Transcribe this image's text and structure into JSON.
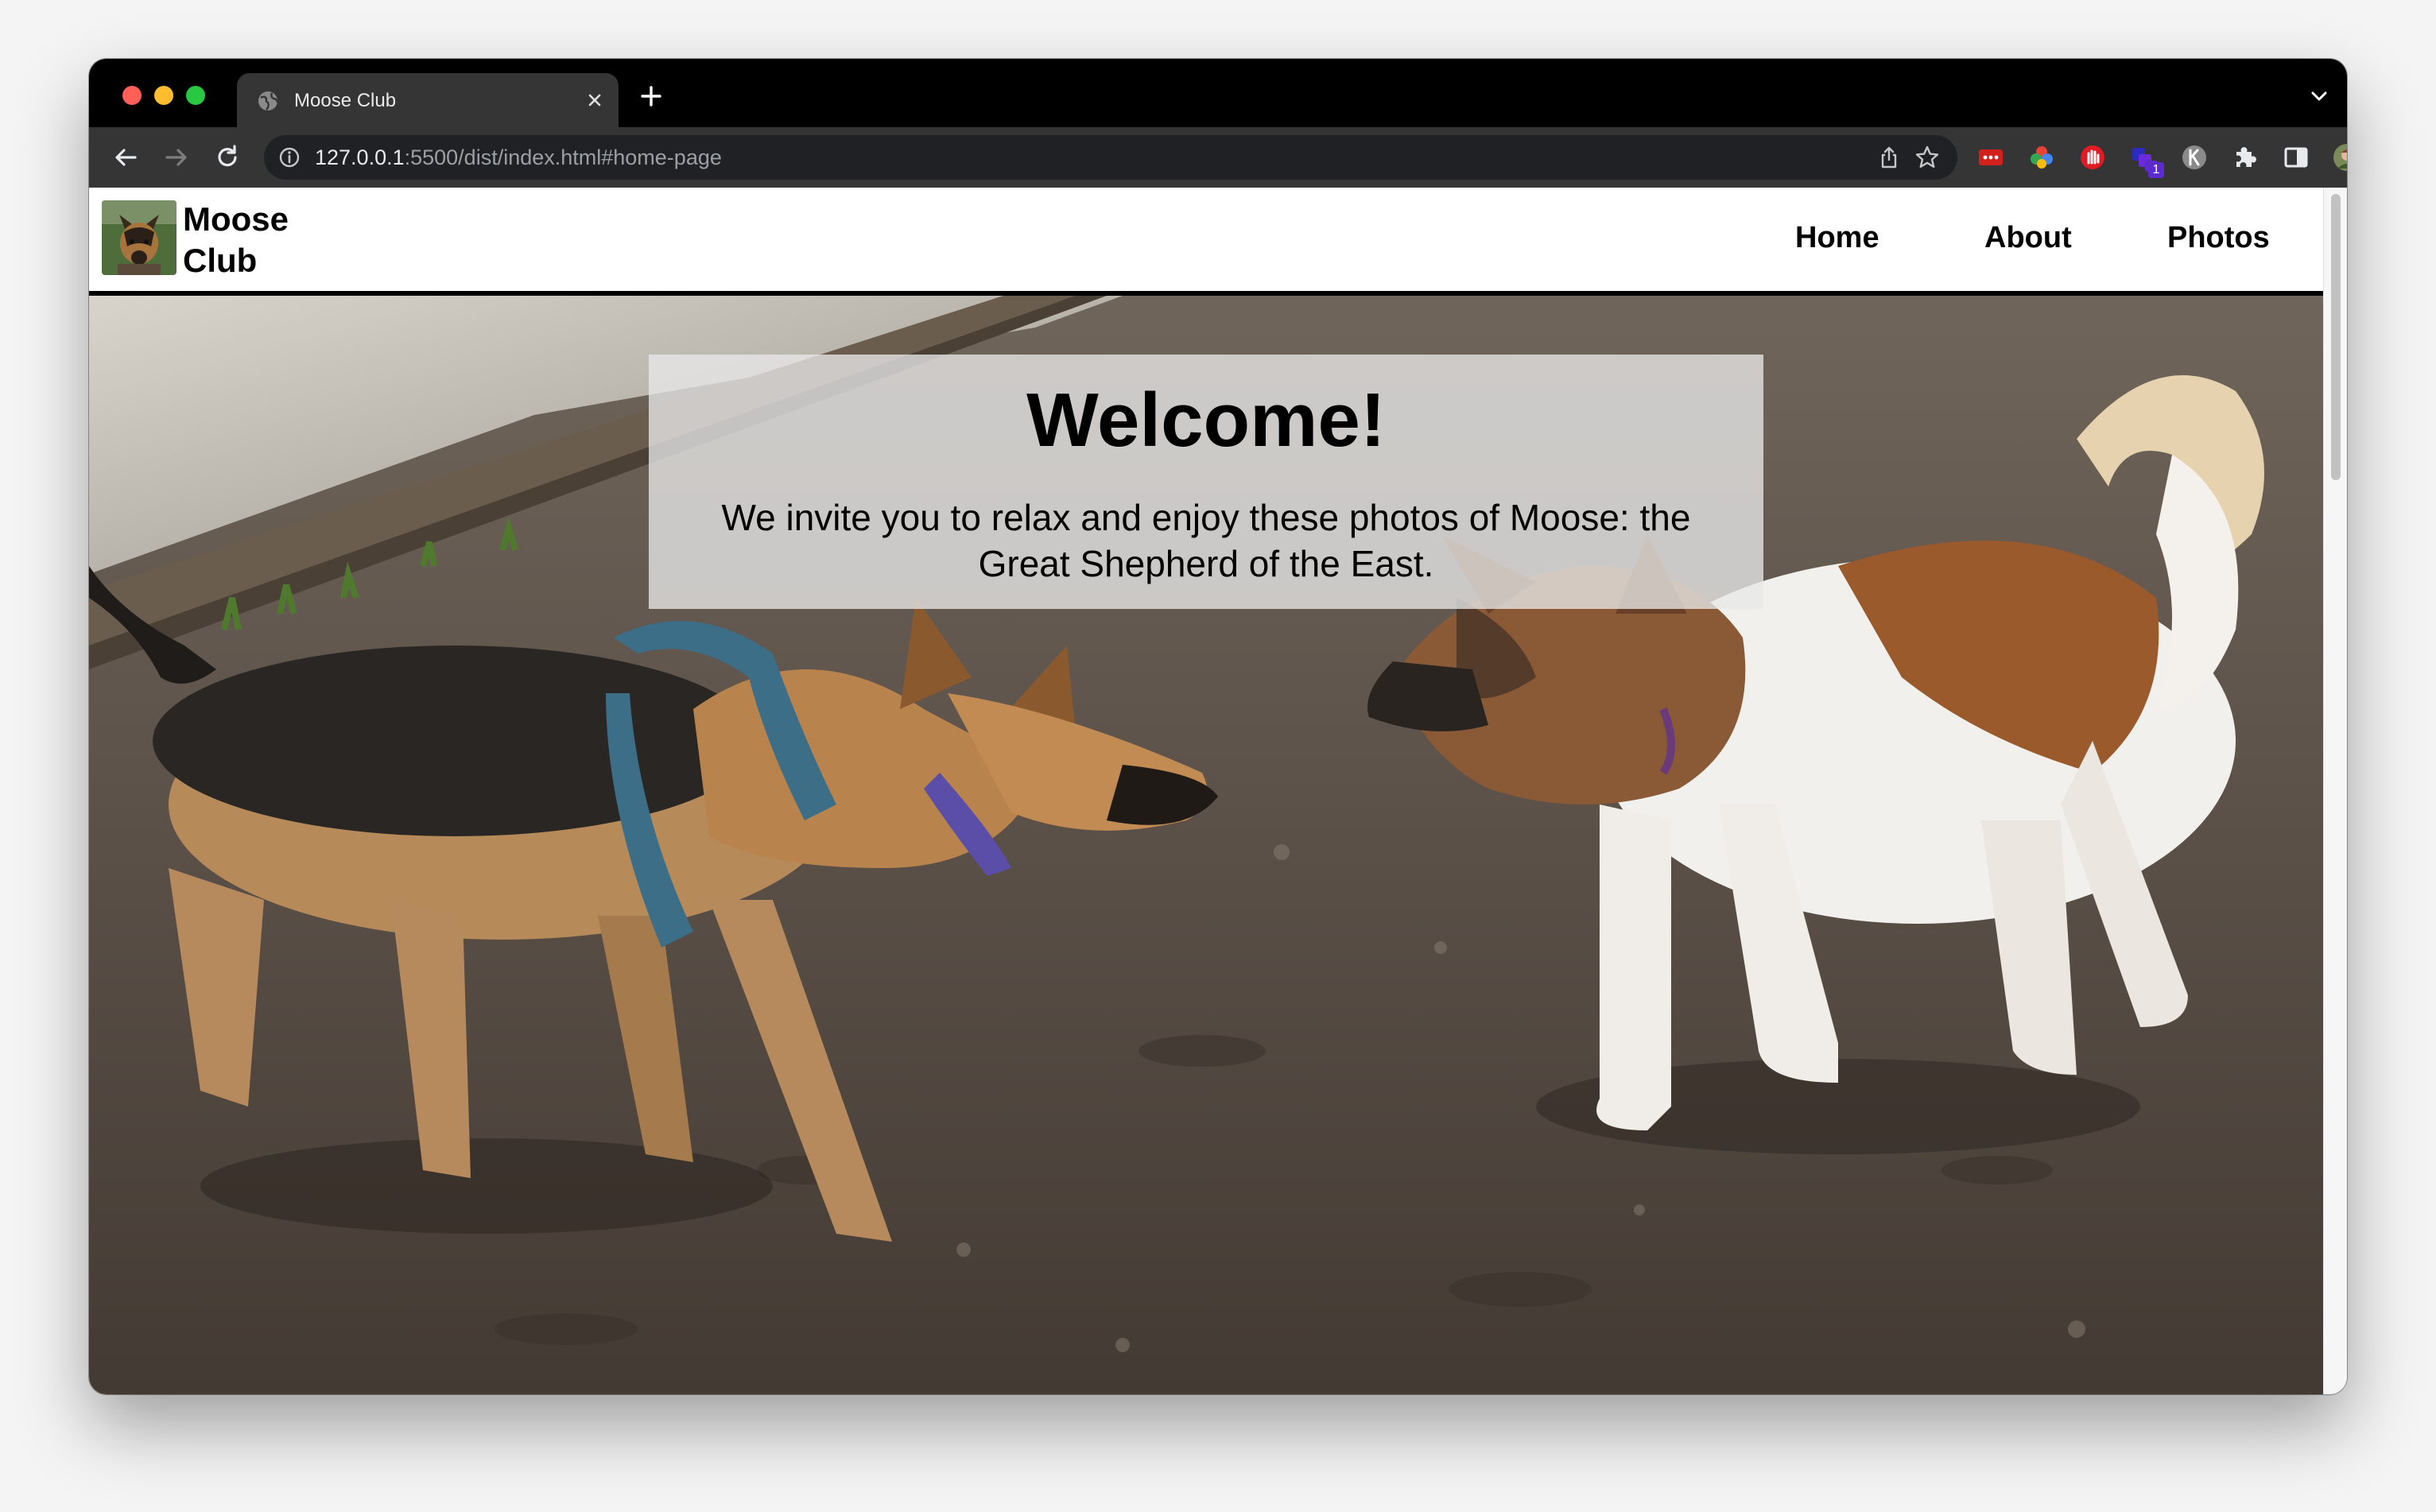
{
  "browser": {
    "tab": {
      "title": "Moose Club"
    },
    "address_bar": {
      "host": "127.0.0.1",
      "path": ":5500/dist/index.html#home-page"
    },
    "extension_badge": "1"
  },
  "site": {
    "brand": {
      "name_line1": "Moose",
      "name_line2": "Club"
    },
    "nav": [
      {
        "label": "Home"
      },
      {
        "label": "About"
      },
      {
        "label": "Photos"
      }
    ],
    "hero": {
      "title": "Welcome!",
      "text": "We invite you to relax and enjoy these photos of Moose: the Great Shepherd of the East."
    }
  },
  "icons": {
    "tab_favicon": "globe-icon",
    "tab_close": "close-icon",
    "new_tab": "plus-icon",
    "back": "arrow-left-icon",
    "forward": "arrow-right-icon",
    "reload": "reload-icon",
    "site_info": "info-icon",
    "share": "share-icon",
    "bookmark": "star-icon",
    "extensions": "puzzle-icon",
    "side_panel": "side-panel-icon",
    "menu": "kebab-menu-icon"
  },
  "colors": {
    "tab_strip": "#000000",
    "toolbar": "#353535",
    "omnibox": "#202124",
    "header_border": "#000000",
    "hero_overlay": "#e8e8e8"
  }
}
